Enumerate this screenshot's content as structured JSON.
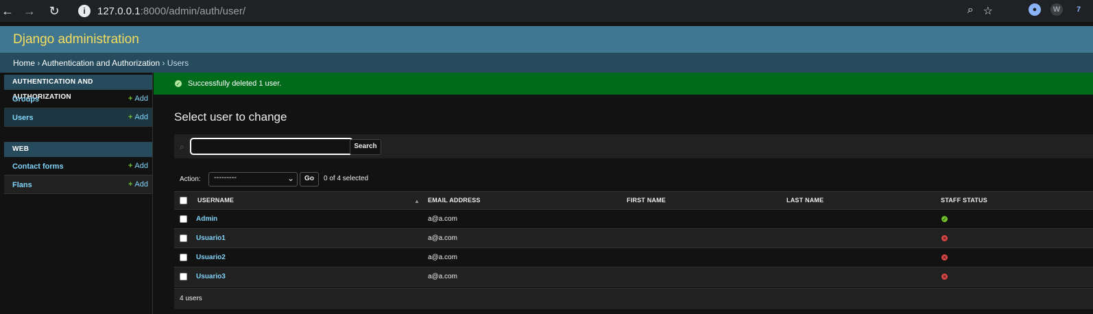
{
  "browser": {
    "url_host": "127.0.0.1",
    "url_rest": ":8000/admin/auth/user/"
  },
  "site": {
    "branding": "Django administration"
  },
  "breadcrumbs": {
    "home": "Home",
    "sep1": " › ",
    "app": "Authentication and Authorization",
    "sep2": " › ",
    "current": "Users"
  },
  "sidebar": {
    "modules": [
      {
        "caption": "AUTHENTICATION AND AUTHORIZATION",
        "rows": [
          {
            "label": "Groups",
            "add": "Add"
          },
          {
            "label": "Users",
            "add": "Add"
          }
        ]
      },
      {
        "caption": "WEB",
        "rows": [
          {
            "label": "Contact forms",
            "add": "Add"
          },
          {
            "label": "Flans",
            "add": "Add"
          }
        ]
      }
    ]
  },
  "message": "Successfully deleted 1 user.",
  "content": {
    "title": "Select user to change",
    "search_button": "Search",
    "search_value": ""
  },
  "actions": {
    "label": "Action:",
    "selected_option": "---------",
    "go": "Go",
    "counter": "0 of 4 selected"
  },
  "table": {
    "columns": [
      "USERNAME",
      "EMAIL ADDRESS",
      "FIRST NAME",
      "LAST NAME",
      "STAFF STATUS"
    ],
    "rows": [
      {
        "username": "Admin",
        "email": "a@a.com",
        "first_name": "",
        "last_name": "",
        "staff": true
      },
      {
        "username": "Usuario1",
        "email": "a@a.com",
        "first_name": "",
        "last_name": "",
        "staff": false
      },
      {
        "username": "Usuario2",
        "email": "a@a.com",
        "first_name": "",
        "last_name": "",
        "staff": false
      },
      {
        "username": "Usuario3",
        "email": "a@a.com",
        "first_name": "",
        "last_name": "",
        "staff": false
      }
    ]
  },
  "paginator": "4 users",
  "colors": {
    "header": "#417690",
    "branding": "#f5dd5d",
    "breadcrumbs": "#264b5d",
    "success": "#006b1b",
    "link": "#81d4fa",
    "add_plus": "#70bf2b",
    "error": "#dd4646"
  }
}
